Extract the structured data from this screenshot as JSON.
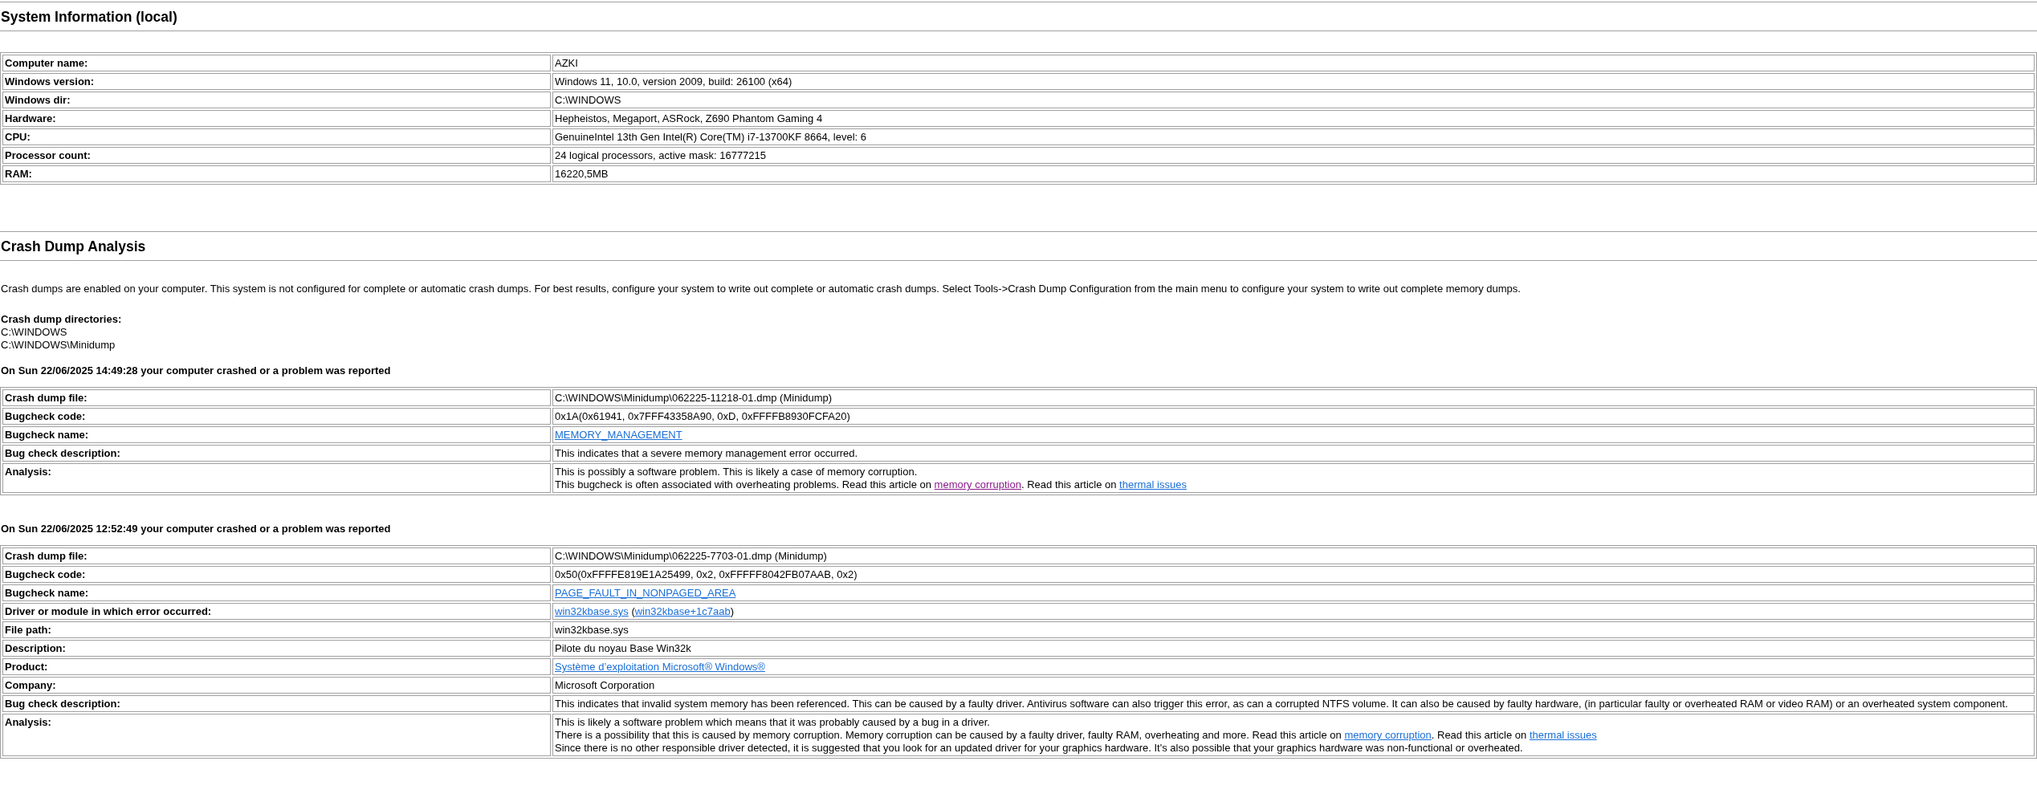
{
  "system_info": {
    "title": "System Information (local)",
    "rows": [
      {
        "label": "Computer name:",
        "value": "AZKI"
      },
      {
        "label": "Windows version:",
        "value": "Windows 11, 10.0, version 2009, build: 26100 (x64)"
      },
      {
        "label": "Windows dir:",
        "value": "C:\\WINDOWS"
      },
      {
        "label": "Hardware:",
        "value": "Hepheistos, Megaport, ASRock, Z690 Phantom Gaming 4"
      },
      {
        "label": "CPU:",
        "value": "GenuineIntel 13th Gen Intel(R) Core(TM) i7-13700KF 8664, level: 6"
      },
      {
        "label": "Processor count:",
        "value": "24 logical processors, active mask: 16777215"
      },
      {
        "label": "RAM:",
        "value": "16220,5MB"
      }
    ]
  },
  "crash_dump_analysis": {
    "title": "Crash Dump Analysis",
    "intro": "Crash dumps are enabled on your computer. This system is not configured for complete or automatic crash dumps. For best results, configure your system to write out complete or automatic crash dumps. Select Tools->Crash Dump Configuration from the main menu to configure your system to write out complete memory dumps.",
    "directories_label": "Crash dump directories:",
    "directories": [
      "C:\\WINDOWS",
      "C:\\WINDOWS\\Minidump"
    ],
    "crashes": [
      {
        "heading": "On Sun 22/06/2025 14:49:28 your computer crashed or a problem was reported",
        "rows": [
          {
            "label": "Crash dump file:",
            "lines": [
              [
                {
                  "kind": "text",
                  "text": "C:\\WINDOWS\\Minidump\\062225-11218-01.dmp (Minidump)"
                }
              ]
            ]
          },
          {
            "label": "Bugcheck code:",
            "lines": [
              [
                {
                  "kind": "text",
                  "text": "0x1A(0x61941, 0x7FFF43358A90, 0xD, 0xFFFFB8930FCFA20)"
                }
              ]
            ]
          },
          {
            "label": "Bugcheck name:",
            "lines": [
              [
                {
                  "kind": "link",
                  "text": "MEMORY_MANAGEMENT",
                  "visited": false
                }
              ]
            ]
          },
          {
            "label": "Bug check description:",
            "lines": [
              [
                {
                  "kind": "text",
                  "text": "This indicates that a severe memory management error occurred."
                }
              ]
            ]
          },
          {
            "label": "Analysis:",
            "lines": [
              [
                {
                  "kind": "text",
                  "text": "This is possibly a software problem. This is likely a case of memory corruption."
                }
              ],
              [
                {
                  "kind": "text",
                  "text": "This bugcheck is often associated with overheating problems. Read this article on "
                },
                {
                  "kind": "link",
                  "text": "memory corruption",
                  "visited": true
                },
                {
                  "kind": "text",
                  "text": ". Read this article on "
                },
                {
                  "kind": "link",
                  "text": "thermal issues",
                  "visited": false
                }
              ]
            ]
          }
        ]
      },
      {
        "heading": "On Sun 22/06/2025 12:52:49 your computer crashed or a problem was reported",
        "rows": [
          {
            "label": "Crash dump file:",
            "lines": [
              [
                {
                  "kind": "text",
                  "text": "C:\\WINDOWS\\Minidump\\062225-7703-01.dmp (Minidump)"
                }
              ]
            ]
          },
          {
            "label": "Bugcheck code:",
            "lines": [
              [
                {
                  "kind": "text",
                  "text": "0x50(0xFFFFE819E1A25499, 0x2, 0xFFFFF8042FB07AAB, 0x2)"
                }
              ]
            ]
          },
          {
            "label": "Bugcheck name:",
            "lines": [
              [
                {
                  "kind": "link",
                  "text": "PAGE_FAULT_IN_NONPAGED_AREA",
                  "visited": false
                }
              ]
            ]
          },
          {
            "label": "Driver or module in which error occurred:",
            "lines": [
              [
                {
                  "kind": "link",
                  "text": "win32kbase.sys",
                  "visited": false
                },
                {
                  "kind": "text",
                  "text": " ("
                },
                {
                  "kind": "link",
                  "text": "win32kbase+1c7aab",
                  "visited": false
                },
                {
                  "kind": "text",
                  "text": ")"
                }
              ]
            ]
          },
          {
            "label": "File path:",
            "lines": [
              [
                {
                  "kind": "text",
                  "text": "win32kbase.sys"
                }
              ]
            ]
          },
          {
            "label": "Description:",
            "lines": [
              [
                {
                  "kind": "text",
                  "text": "Pilote du noyau Base Win32k"
                }
              ]
            ]
          },
          {
            "label": "Product:",
            "lines": [
              [
                {
                  "kind": "link",
                  "text": "Système d’exploitation Microsoft® Windows®",
                  "visited": false
                }
              ]
            ]
          },
          {
            "label": "Company:",
            "lines": [
              [
                {
                  "kind": "text",
                  "text": "Microsoft Corporation"
                }
              ]
            ]
          },
          {
            "label": "Bug check description:",
            "lines": [
              [
                {
                  "kind": "text",
                  "text": "This indicates that invalid system memory has been referenced. This can be caused by a faulty driver. Antivirus software can also trigger this error, as can a corrupted NTFS volume. It can also be caused by faulty hardware, (in particular faulty or overheated RAM or video RAM) or an overheated system component."
                }
              ]
            ]
          },
          {
            "label": "Analysis:",
            "lines": [
              [
                {
                  "kind": "text",
                  "text": "This is likely a software problem which means that it was probably caused by a bug in a driver."
                }
              ],
              [
                {
                  "kind": "text",
                  "text": "There is a possibility that this is caused by memory corruption. Memory corruption can be caused by a faulty driver, faulty RAM, overheating and more. Read this article on "
                },
                {
                  "kind": "link",
                  "text": "memory corruption",
                  "visited": false
                },
                {
                  "kind": "text",
                  "text": ". Read this article on "
                },
                {
                  "kind": "link",
                  "text": "thermal issues",
                  "visited": false
                }
              ],
              [
                {
                  "kind": "text",
                  "text": "Since there is no other responsible driver detected, it is suggested that you look for an updated driver for your graphics hardware. It's also possible that your graphics hardware was non-functional or overheated."
                }
              ]
            ]
          }
        ]
      }
    ]
  }
}
